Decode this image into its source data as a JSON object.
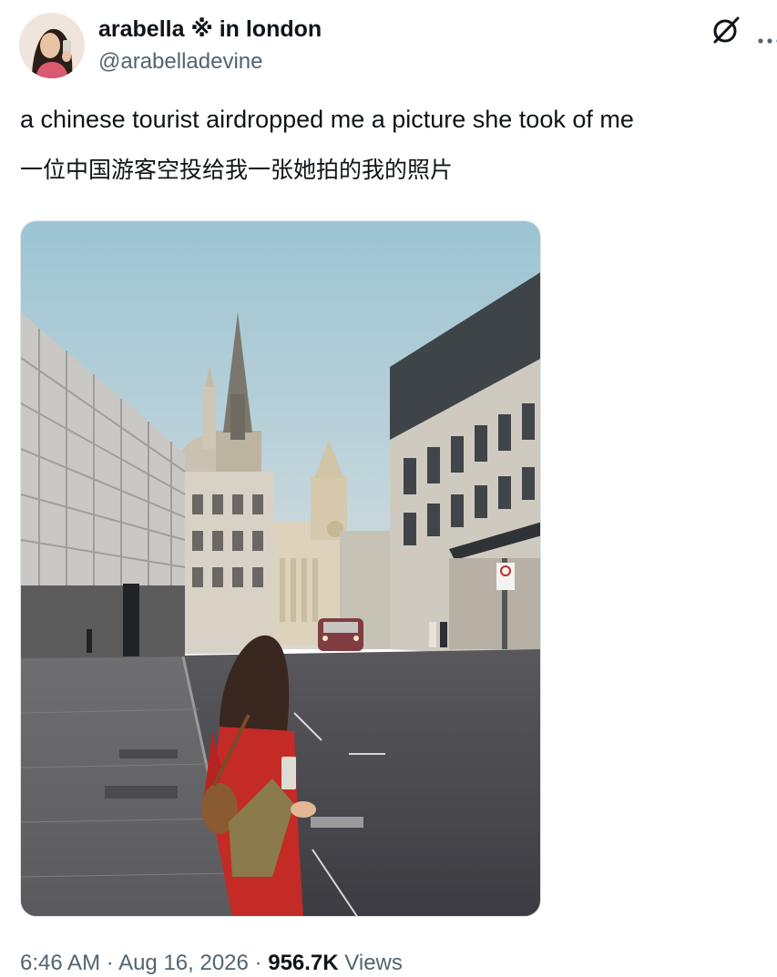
{
  "author": {
    "display_name": "arabella ※ in london",
    "handle": "@arabelladevine"
  },
  "tweet": {
    "line_en": "a chinese tourist airdropped me a picture she took of me",
    "line_zh": "一位中国游客空投给我一张她拍的我的照片"
  },
  "meta": {
    "time": "6:46 AM",
    "separator": "·",
    "date": "Aug 16, 2026",
    "views_count": "956.7K",
    "views_label": "Views"
  },
  "icons": {
    "grok": "grok-icon",
    "more": "more-dots-icon",
    "avatar": "avatar"
  },
  "colors": {
    "text": "#0f1419",
    "secondary": "#536471",
    "dress": "#c42a26"
  }
}
